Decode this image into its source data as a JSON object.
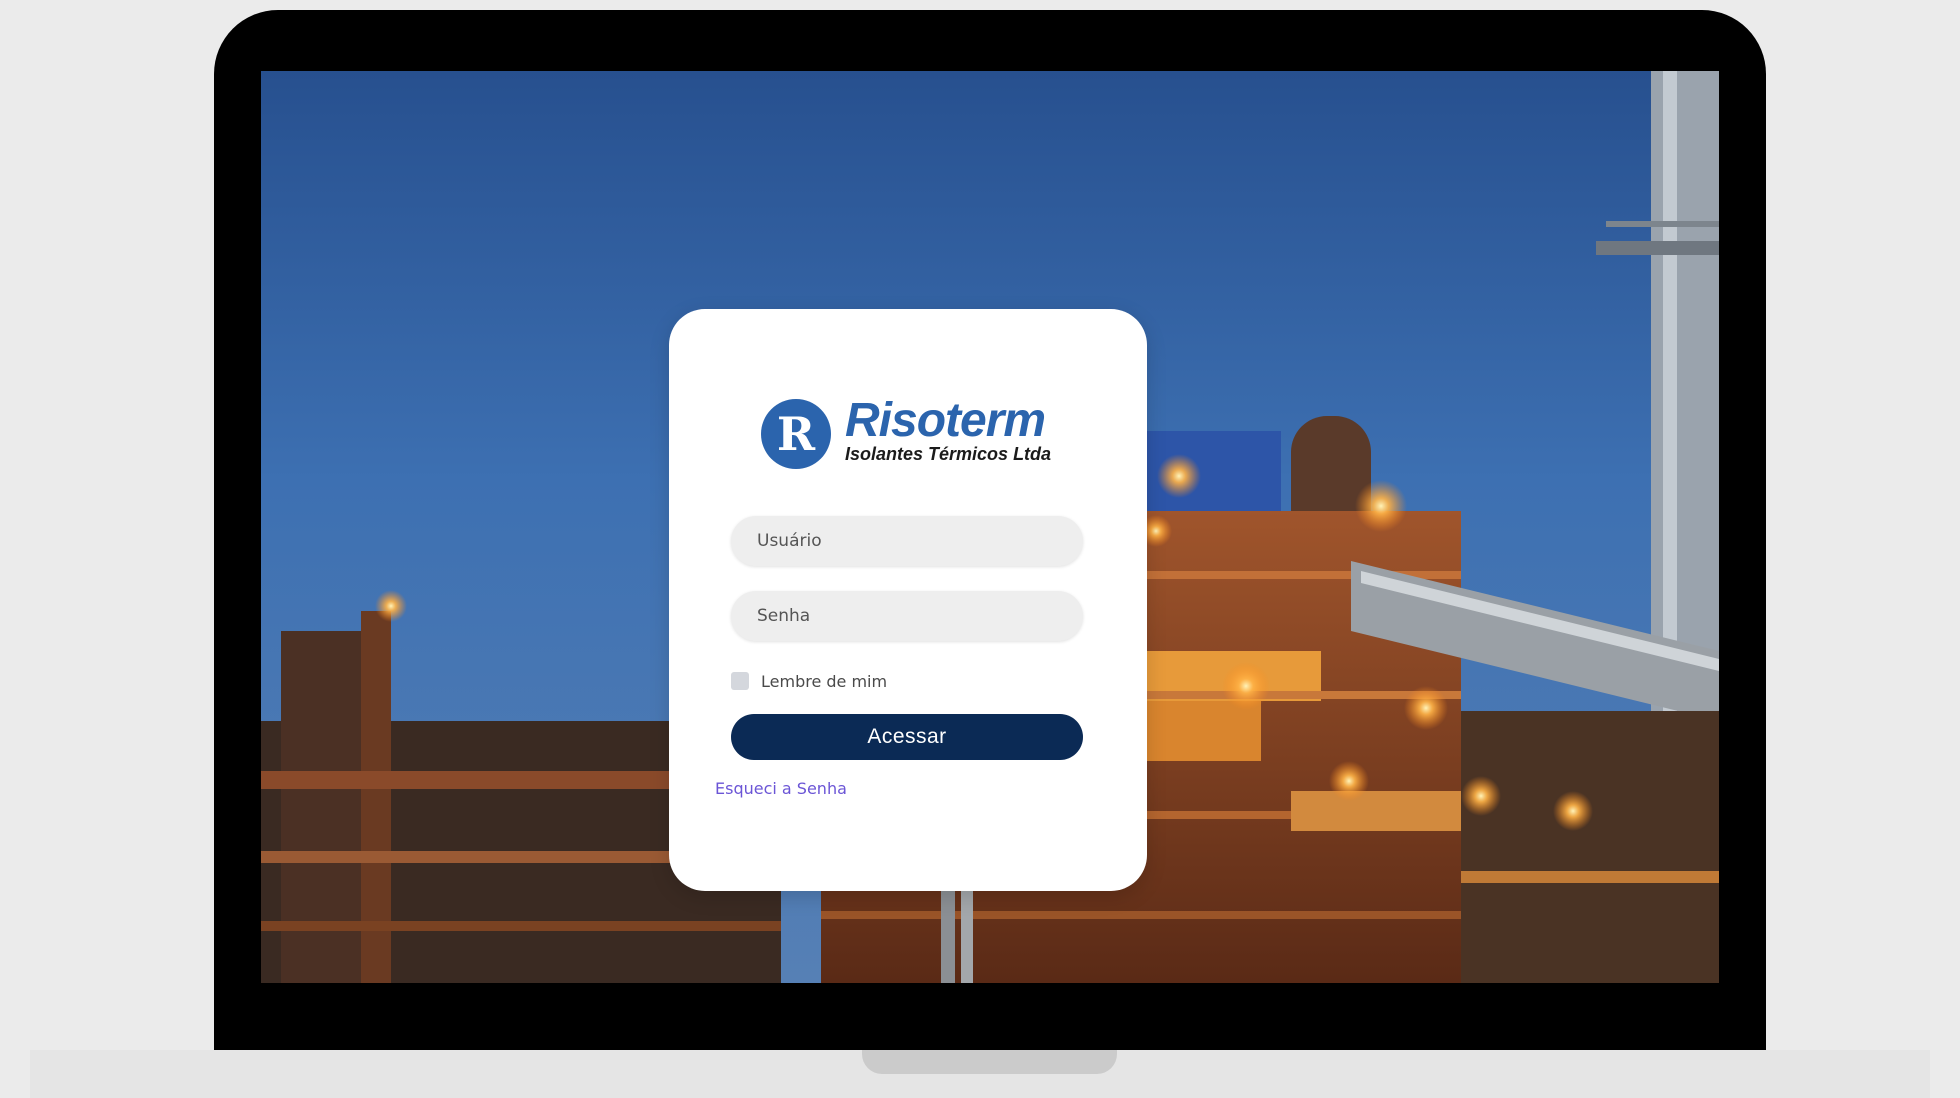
{
  "colors": {
    "brand_blue": "#2b64ad",
    "button_navy": "#0b2a55",
    "link_purple": "#6b55d6",
    "card_background": "#ffffff",
    "bezel": "#000000"
  },
  "background": {
    "image": "industrial plant at dusk"
  },
  "logo": {
    "mark": "R",
    "name": "Risoterm",
    "tagline": "Isolantes Térmicos Ltda"
  },
  "login": {
    "username": {
      "placeholder": "Usuário",
      "value": ""
    },
    "password": {
      "placeholder": "Senha",
      "value": ""
    },
    "remember_label": "Lembre de mim",
    "remember_checked": false,
    "submit_label": "Acessar",
    "forgot_label": "Esqueci a Senha"
  }
}
